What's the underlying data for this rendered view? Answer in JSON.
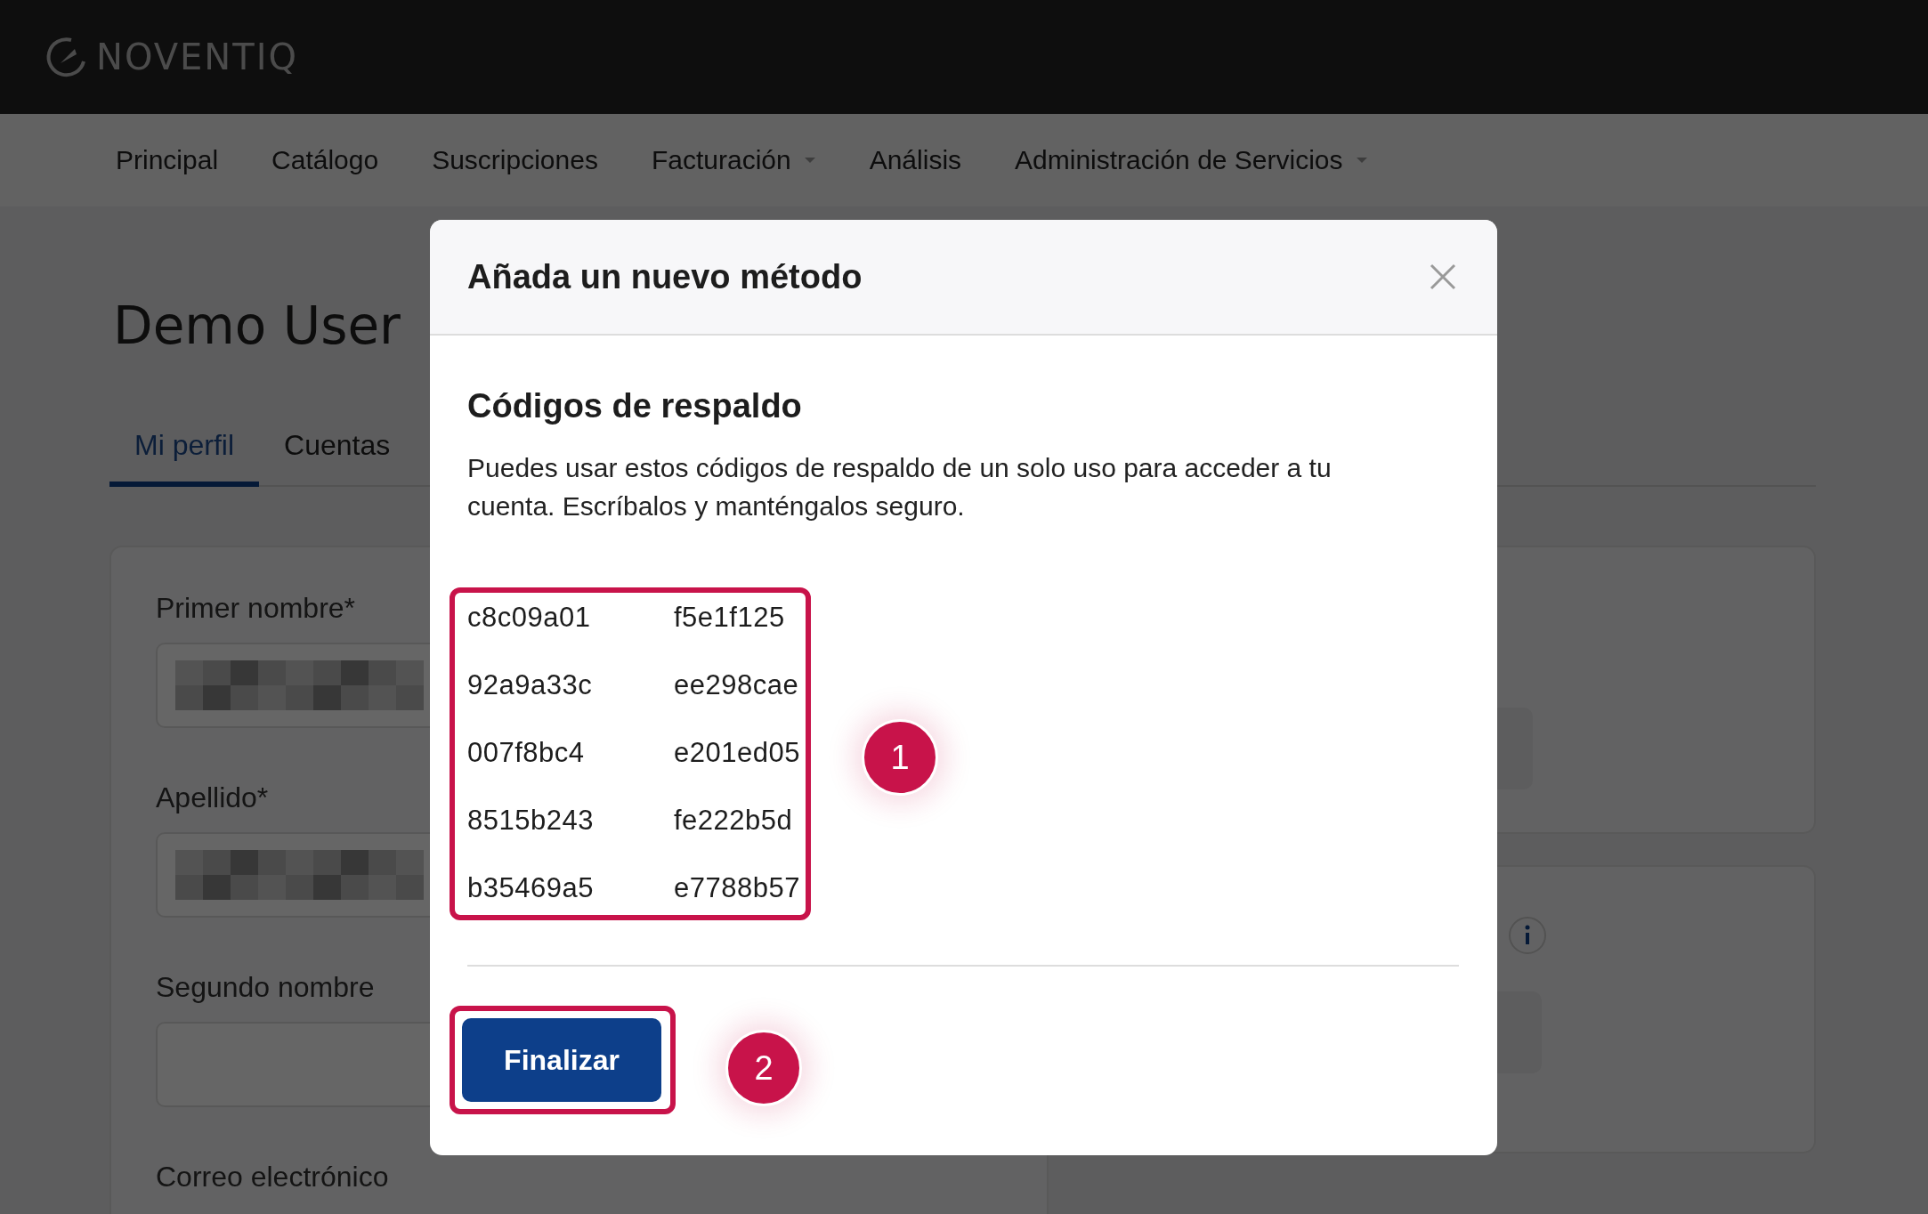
{
  "logo": {
    "text": "NOVENTIQ"
  },
  "nav": [
    {
      "label": "Principal",
      "dropdown": false
    },
    {
      "label": "Catálogo",
      "dropdown": false
    },
    {
      "label": "Suscripciones",
      "dropdown": false
    },
    {
      "label": "Facturación",
      "dropdown": true
    },
    {
      "label": "Análisis",
      "dropdown": false
    },
    {
      "label": "Administración de Servicios",
      "dropdown": true
    }
  ],
  "page": {
    "title": "Demo User",
    "tabs": [
      {
        "label": "Mi perfil",
        "selected": true
      },
      {
        "label": "Cuentas",
        "selected": false
      }
    ],
    "fields": [
      {
        "label": "Primer nombre*",
        "kind": "redacted"
      },
      {
        "label": "Apellido*",
        "kind": "redacted"
      },
      {
        "label": "Segundo nombre",
        "kind": "empty"
      },
      {
        "label": "Correo electrónico",
        "kind": "label_only"
      }
    ]
  },
  "modal": {
    "title": "Añada un nuevo método",
    "heading": "Códigos de respaldo",
    "description": "Puedes usar estos códigos de respaldo de un solo uso para acceder a tu cuenta. Escríbalos y manténgalos seguro.",
    "codes": [
      "c8c09a01",
      "f5e1f125",
      "92a9a33c",
      "ee298cae",
      "007f8bc4",
      "e201ed05",
      "8515b243",
      "fe222b5d",
      "b35469a5",
      "e7788b57"
    ],
    "button": "Finalizar",
    "callouts": [
      "1",
      "2"
    ]
  }
}
